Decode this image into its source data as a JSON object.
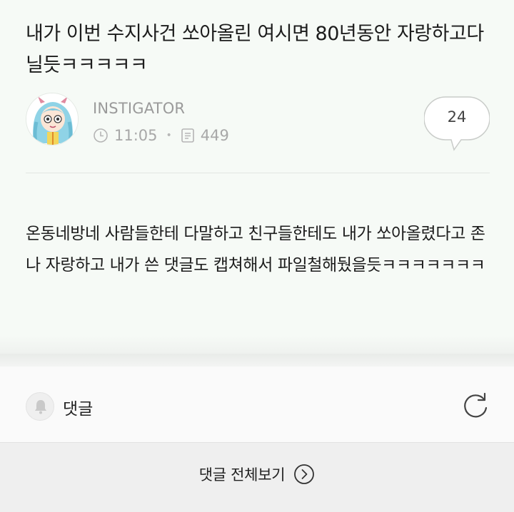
{
  "post": {
    "title": "내가 이번 수지사건 쏘아올린 여시면 80년동안 자랑하고다닐듯ㅋㅋㅋㅋㅋ",
    "author": "INSTIGATOR",
    "time": "11:05",
    "views": "449",
    "comment_count": "24",
    "body": "온동네방네 사람들한테 다말하고 친구들한테도 내가 쏘아올렸다고 존나 자랑하고 내가 쓴 댓글도 캡쳐해서 파일철해뒀을듯ㅋㅋㅋㅋㅋㅋㅋ"
  },
  "comments": {
    "label": "댓글",
    "view_all_label": "댓글 전체보기"
  },
  "icons": {
    "clock": "clock-icon",
    "views": "document-icon",
    "bubble": "speech-bubble-icon",
    "bell": "bell-icon",
    "refresh": "refresh-icon",
    "arrow": "chevron-right-circle-icon"
  },
  "colors": {
    "background": "#f6faf6",
    "muted_text": "#a8a8a8",
    "text": "#1c1c1c"
  }
}
